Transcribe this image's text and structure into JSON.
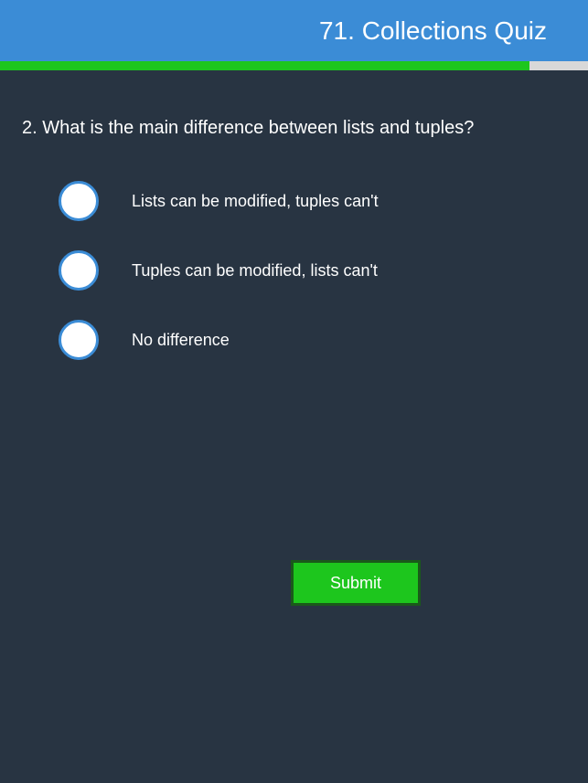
{
  "header": {
    "title": "71. Collections Quiz"
  },
  "progress": {
    "percent": 90
  },
  "question": {
    "number": "2",
    "text": "2. What is the main difference between lists and tuples?",
    "options": [
      "Lists can be modified, tuples can't",
      "Tuples can be modified, lists can't",
      "No difference"
    ]
  },
  "buttons": {
    "submit": "Submit"
  }
}
